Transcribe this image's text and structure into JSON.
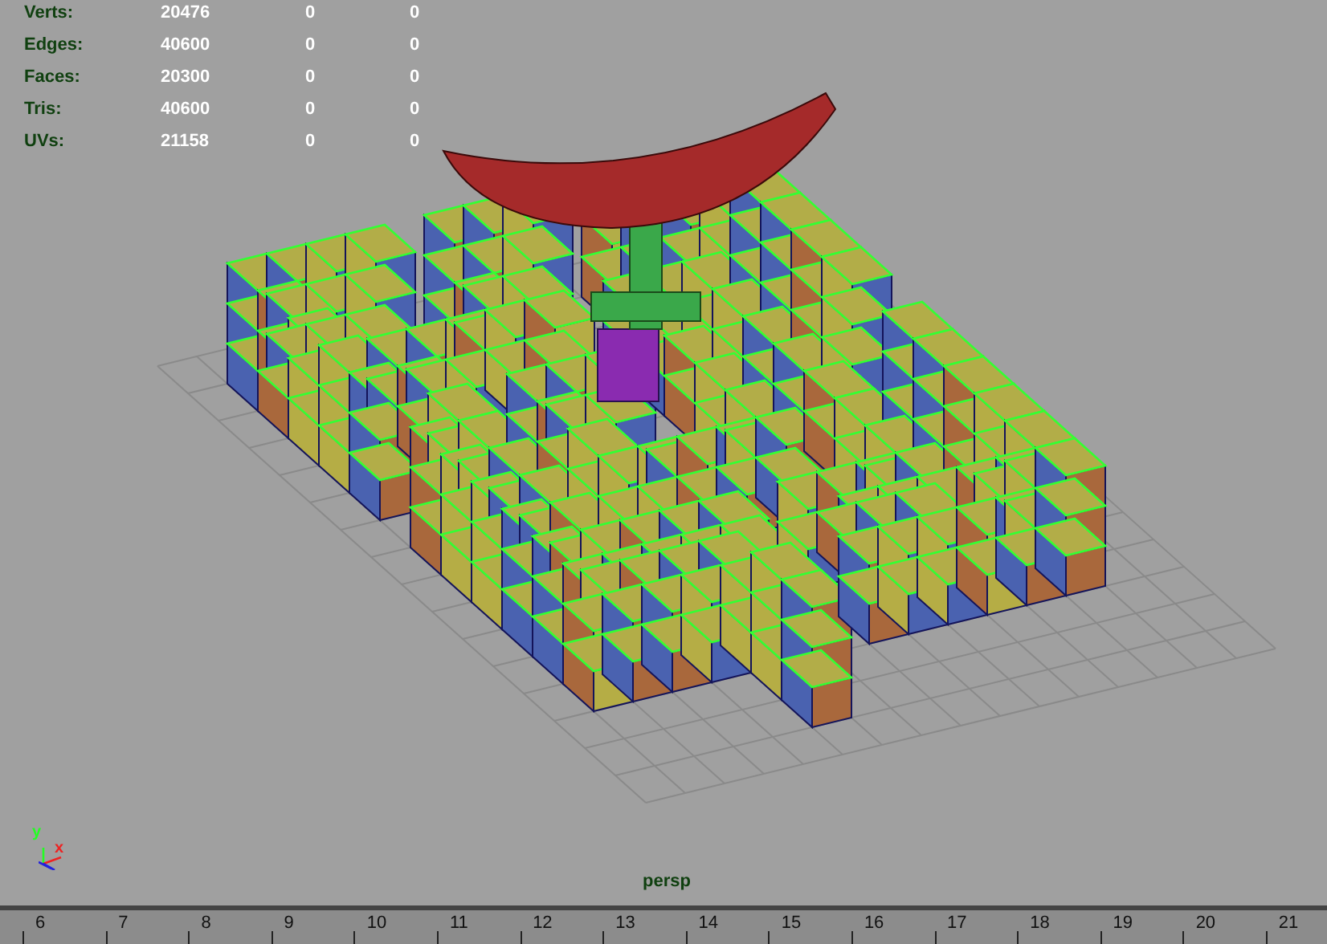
{
  "viewport": {
    "stats": [
      {
        "label": "Verts:",
        "values": [
          "20476",
          "0",
          "0"
        ]
      },
      {
        "label": "Edges:",
        "values": [
          "40600",
          "0",
          "0"
        ]
      },
      {
        "label": "Faces:",
        "values": [
          "20300",
          "0",
          "0"
        ]
      },
      {
        "label": "Tris:",
        "values": [
          "40600",
          "0",
          "0"
        ]
      },
      {
        "label": "UVs:",
        "values": [
          "21158",
          "0",
          "0"
        ]
      }
    ],
    "axis_labels": {
      "y": "y",
      "x": "x"
    },
    "camera_label": "persp"
  },
  "time_slider": {
    "frames": [
      "6",
      "7",
      "8",
      "9",
      "10",
      "11",
      "12",
      "13",
      "14",
      "15",
      "16",
      "17",
      "18",
      "19",
      "20",
      "21"
    ]
  }
}
